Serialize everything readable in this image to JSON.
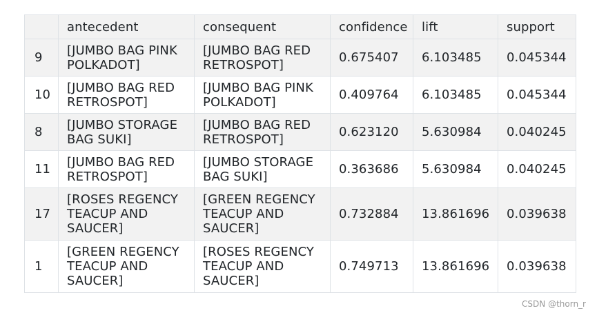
{
  "table": {
    "columns": [
      "",
      "antecedent",
      "consequent",
      "confidence",
      "lift",
      "support"
    ],
    "rows": [
      {
        "index": "9",
        "antecedent": "[JUMBO BAG PINK POLKADOT]",
        "consequent": "[JUMBO BAG RED RETROSPOT]",
        "confidence": "0.675407",
        "lift": "6.103485",
        "support": "0.045344"
      },
      {
        "index": "10",
        "antecedent": "[JUMBO BAG RED RETROSPOT]",
        "consequent": "[JUMBO BAG PINK POLKADOT]",
        "confidence": "0.409764",
        "lift": "6.103485",
        "support": "0.045344"
      },
      {
        "index": "8",
        "antecedent": "[JUMBO STORAGE BAG SUKI]",
        "consequent": "[JUMBO BAG RED RETROSPOT]",
        "confidence": "0.623120",
        "lift": "5.630984",
        "support": "0.040245"
      },
      {
        "index": "11",
        "antecedent": "[JUMBO BAG RED RETROSPOT]",
        "consequent": "[JUMBO STORAGE BAG SUKI]",
        "confidence": "0.363686",
        "lift": "5.630984",
        "support": "0.040245"
      },
      {
        "index": "17",
        "antecedent": "[ROSES REGENCY TEACUP AND SAUCER]",
        "consequent": "[GREEN REGENCY TEACUP AND SAUCER]",
        "confidence": "0.732884",
        "lift": "13.861696",
        "support": "0.039638"
      },
      {
        "index": "1",
        "antecedent": "[GREEN REGENCY TEACUP AND SAUCER]",
        "consequent": "[ROSES REGENCY TEACUP AND SAUCER]",
        "confidence": "0.749713",
        "lift": "13.861696",
        "support": "0.039638"
      }
    ]
  },
  "watermark": "CSDN @thorn_r",
  "colors": {
    "header_bg": "#f2f2f2",
    "stripe_bg": "#f2f2f2",
    "border": "#dee2e6",
    "text": "#212529"
  }
}
